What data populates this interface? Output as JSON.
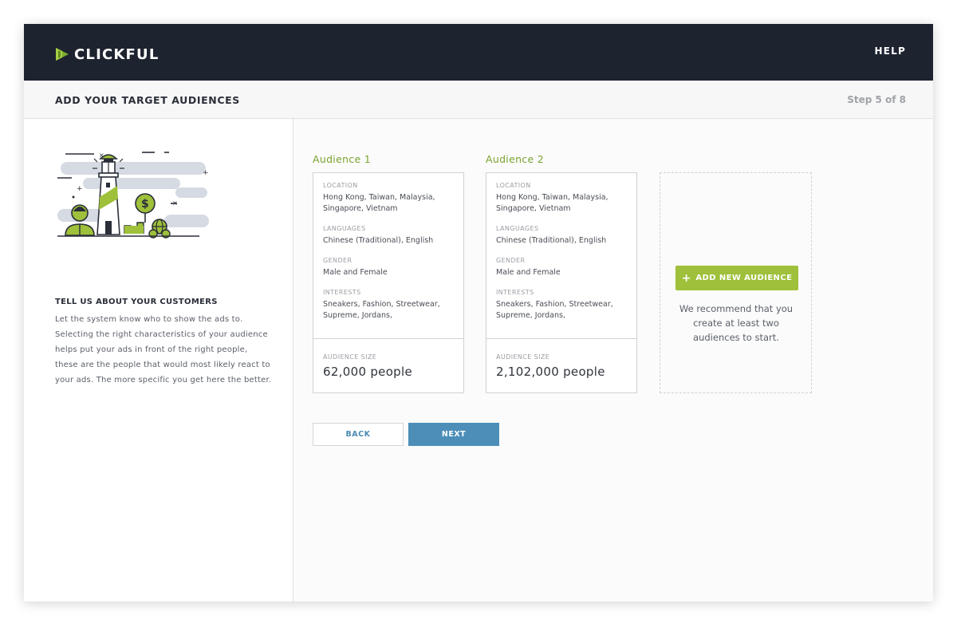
{
  "header": {
    "logo_text": "CLICKFUL",
    "help_label": "HELP"
  },
  "subheader": {
    "title": "ADD YOUR TARGET AUDIENCES",
    "step": "Step 5 of 8"
  },
  "sidebar": {
    "heading": "TELL US ABOUT YOUR CUSTOMERS",
    "body": "Let the system know who to show the ads to. Selecting the right characteristics of your audience helps put your ads in front of the right people, these are the people that would most likely react to your ads. The more specific you get here the better."
  },
  "audiences": [
    {
      "title": "Audience 1",
      "location_label": "LOCATION",
      "location": "Hong Kong, Taiwan, Malaysia, Singapore, Vietnam",
      "languages_label": "LANGUAGES",
      "languages": "Chinese (Traditional), English",
      "gender_label": "GENDER",
      "gender": "Male and Female",
      "interests_label": "INTERESTS",
      "interests": "Sneakers, Fashion, Streetwear, Supreme, Jordans,",
      "size_label": "AUDIENCE SIZE",
      "size": "62,000 people"
    },
    {
      "title": "Audience 2",
      "location_label": "LOCATION",
      "location": "Hong Kong, Taiwan, Malaysia, Singapore, Vietnam",
      "languages_label": "LANGUAGES",
      "languages": "Chinese (Traditional), English",
      "gender_label": "GENDER",
      "gender": "Male and Female",
      "interests_label": "INTERESTS",
      "interests": "Sneakers, Fashion, Streetwear, Supreme, Jordans,",
      "size_label": "AUDIENCE SIZE",
      "size": "2,102,000 people"
    }
  ],
  "add_audience": {
    "button_icon": "+",
    "button_label": "ADD NEW AUDIENCE",
    "recommendation": "We recommend that you create at least two audiences to start."
  },
  "nav": {
    "back_label": "BACK",
    "next_label": "NEXT"
  },
  "colors": {
    "topbar": "#1e2330",
    "accent_green": "#9ec03a",
    "audience_title": "#7aa32e",
    "primary_blue": "#4c8eb8"
  },
  "icons": {
    "logo": "play-arrow-logo-icon",
    "illustration": "lighthouse-customer-illustration"
  }
}
